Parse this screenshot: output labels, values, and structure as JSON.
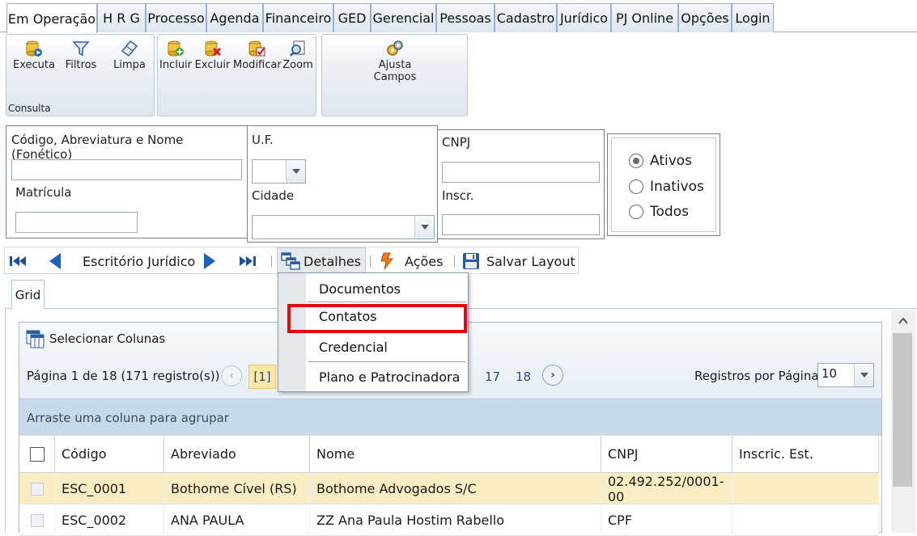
{
  "tabs": [
    "Em Operação",
    "H R G",
    "Processo",
    "Agenda",
    "Financeiro",
    "GED",
    "Gerencial",
    "Pessoas",
    "Cadastro",
    "Jurídico",
    "PJ Online",
    "Opções",
    "Login"
  ],
  "ribbon": {
    "group1": {
      "label": "Consulta",
      "buttons": [
        "Executa",
        "Filtros",
        "Limpa"
      ]
    },
    "group2": {
      "buttons": [
        "Incluir",
        "Excluir",
        "Modificar",
        "Zoom"
      ]
    },
    "group3": {
      "buttons": [
        "Ajusta\nCampos"
      ],
      "line1": "Ajusta",
      "line2": "Campos"
    }
  },
  "filters": {
    "codigo_label": "Código, Abreviatura e Nome (Fonético)",
    "codigo_value": "",
    "matricula_label": "Matrícula",
    "matricula_value": "",
    "uf_label": "U.F.",
    "uf_value": "",
    "cidade_label": "Cidade",
    "cidade_value": "",
    "cnpj_label": "CNPJ",
    "cnpj_value": "",
    "inscr_label": "Inscr.",
    "inscr_value": "",
    "status_options": [
      "Ativos",
      "Inativos",
      "Todos"
    ],
    "status_selected": "Ativos"
  },
  "nav": {
    "record_label": "Escritório Jurídico",
    "detalhes": "Detalhes",
    "acoes": "Ações",
    "salvar_layout": "Salvar Layout"
  },
  "menu": {
    "items": [
      "Documentos",
      "Contatos",
      "Credencial",
      "Plano e Patrocinadora"
    ],
    "highlighted": "Contatos"
  },
  "grid": {
    "tab_label": "Grid",
    "select_columns": "Selecionar Colunas",
    "page_info": "Página 1 de 18 (171 registro(s))",
    "current_page": "[1]",
    "page_17": "17",
    "page_18": "18",
    "per_page_label": "Registros por Página",
    "per_page_value": "10",
    "group_hint": "Arraste uma coluna para agrupar",
    "columns": [
      "Código",
      "Abreviado",
      "Nome",
      "CNPJ",
      "Inscric. Est."
    ],
    "rows": [
      {
        "codigo": "ESC_0001",
        "abreviado": "Bothome Cível (RS)",
        "nome": "Bothome Advogados S/C",
        "cnpj": "02.492.252/0001-00",
        "inscr": ""
      },
      {
        "codigo": "ESC_0002",
        "abreviado": "ANA PAULA",
        "nome": "ZZ Ana Paula Hostim Rabello",
        "cnpj": "CPF",
        "inscr": ""
      }
    ]
  },
  "colors": {
    "accent_highlight": "#e20b0b",
    "selected_row": "#faedc4",
    "group_hint_bg": "#c8d9ea"
  }
}
